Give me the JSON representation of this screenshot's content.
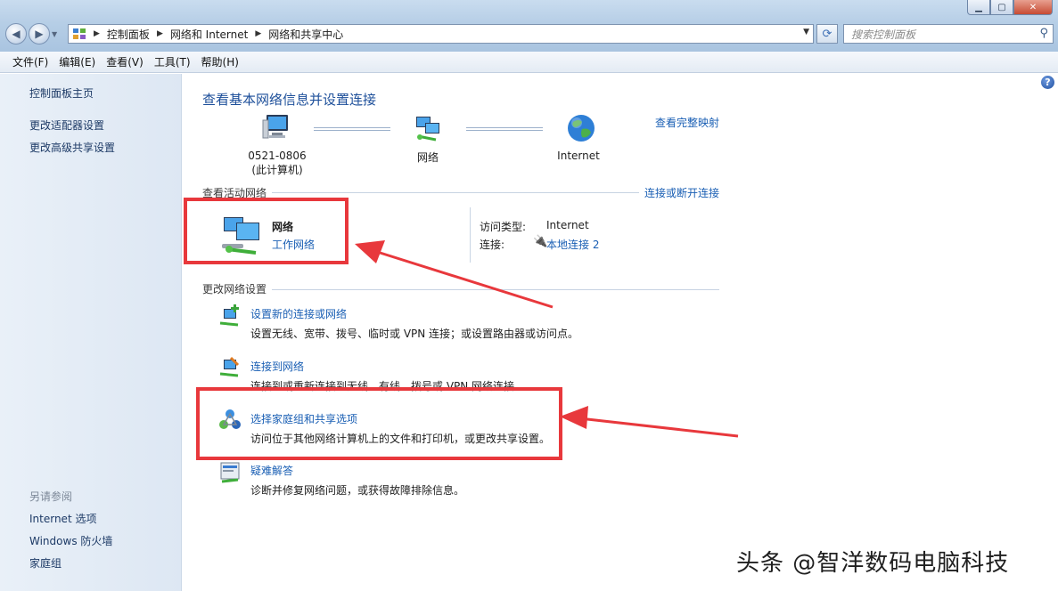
{
  "window": {
    "address": [
      "控制面板",
      "网络和 Internet",
      "网络和共享中心"
    ],
    "search_placeholder": "搜索控制面板"
  },
  "menu": [
    "文件(F)",
    "编辑(E)",
    "查看(V)",
    "工具(T)",
    "帮助(H)"
  ],
  "sidebar": {
    "links": [
      "控制面板主页",
      "更改适配器设置",
      "更改高级共享设置"
    ],
    "see_also_title": "另请参阅",
    "see_also": [
      "Internet 选项",
      "Windows 防火墙",
      "家庭组"
    ]
  },
  "main": {
    "title": "查看基本网络信息并设置连接",
    "view_full_map": "查看完整映射",
    "map": {
      "computer_name": "0521-0806",
      "computer_sub": "(此计算机)",
      "network": "网络",
      "internet": "Internet"
    },
    "active_header": "查看活动网络",
    "connect_disconnect": "连接或断开连接",
    "active": {
      "name": "网络",
      "type": "工作网络",
      "access_label": "访问类型:",
      "access_value": "Internet",
      "conn_label": "连接:",
      "conn_value": "本地连接 2"
    },
    "change_header": "更改网络设置",
    "tasks": [
      {
        "link": "设置新的连接或网络",
        "desc": "设置无线、宽带、拨号、临时或 VPN 连接；或设置路由器或访问点。"
      },
      {
        "link": "连接到网络",
        "desc": "连接到或重新连接到无线、有线、拨号或 VPN 网络连接。"
      },
      {
        "link": "选择家庭组和共享选项",
        "desc": "访问位于其他网络计算机上的文件和打印机，或更改共享设置。"
      },
      {
        "link": "疑难解答",
        "desc": "诊断并修复网络问题，或获得故障排除信息。"
      }
    ]
  },
  "watermark": "头条 @智洋数码电脑科技",
  "colors": {
    "link": "#1a5fb4",
    "highlight": "#e8383c",
    "title": "#1d4f9a"
  }
}
